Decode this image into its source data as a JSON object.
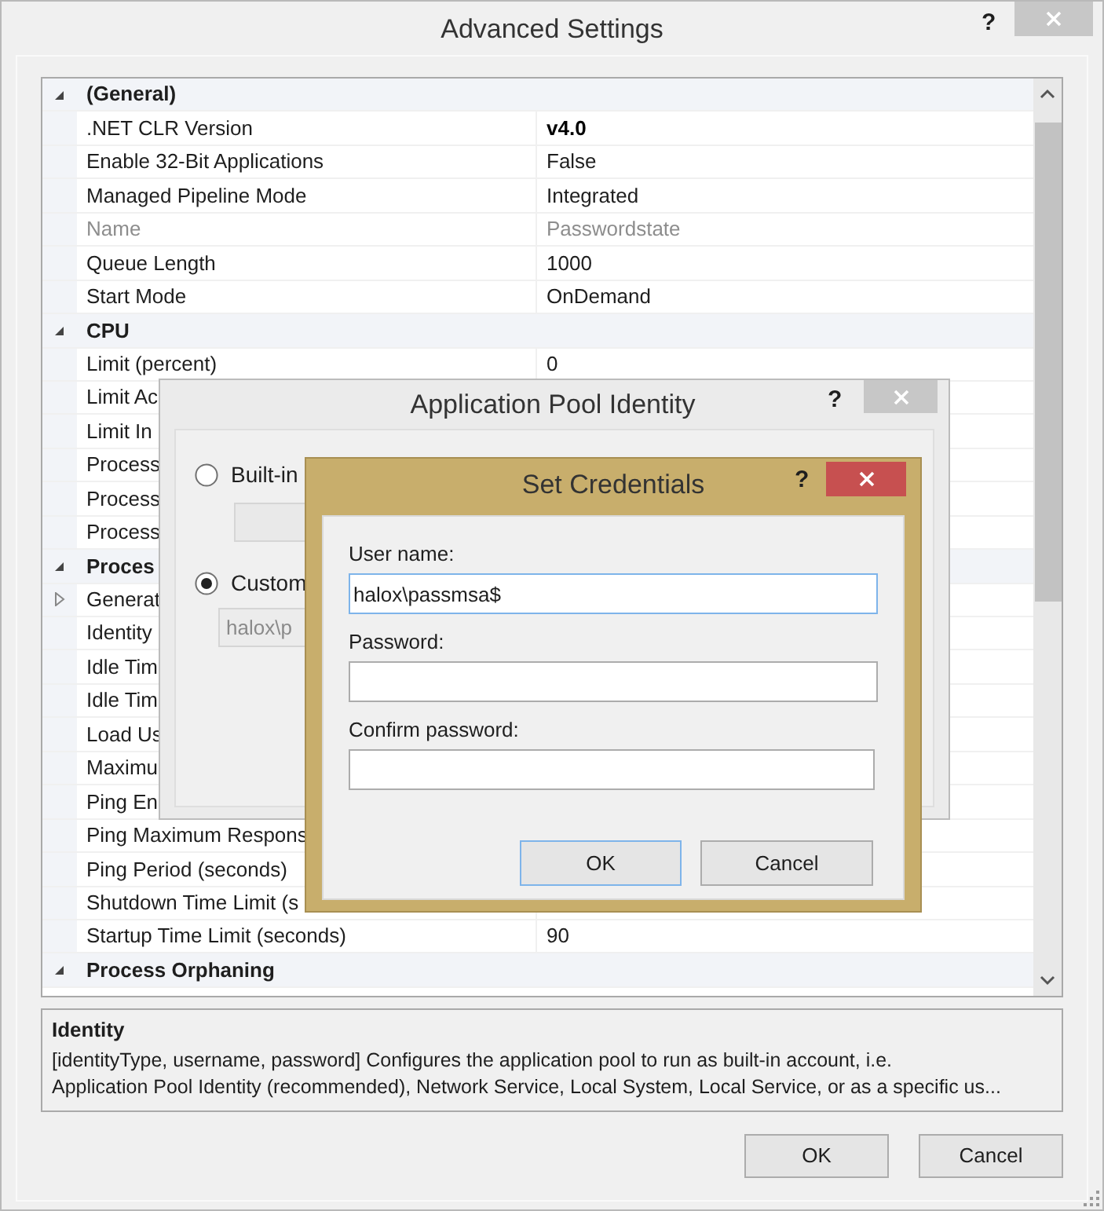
{
  "window": {
    "title": "Advanced Settings",
    "help": "?"
  },
  "property_grid": {
    "rows": [
      {
        "kind": "category",
        "name": "(General)",
        "expanded": true
      },
      {
        "kind": "property",
        "name": ".NET CLR Version",
        "value": "v4.0",
        "modified": true,
        "disabled": false
      },
      {
        "kind": "property",
        "name": "Enable 32-Bit Applications",
        "value": "False",
        "modified": false,
        "disabled": false
      },
      {
        "kind": "property",
        "name": "Managed Pipeline Mode",
        "value": "Integrated",
        "modified": false,
        "disabled": false
      },
      {
        "kind": "property",
        "name": "Name",
        "value": "Passwordstate",
        "modified": false,
        "disabled": true
      },
      {
        "kind": "property",
        "name": "Queue Length",
        "value": "1000",
        "modified": false,
        "disabled": false
      },
      {
        "kind": "property",
        "name": "Start Mode",
        "value": "OnDemand",
        "modified": false,
        "disabled": false
      },
      {
        "kind": "category",
        "name": "CPU",
        "expanded": true
      },
      {
        "kind": "property",
        "name": "Limit (percent)",
        "value": "0",
        "modified": false,
        "disabled": false
      },
      {
        "kind": "property",
        "name": "Limit Ac",
        "disabled": false
      },
      {
        "kind": "property",
        "name": "Limit In",
        "disabled": false
      },
      {
        "kind": "property",
        "name": "Process",
        "disabled": false
      },
      {
        "kind": "property",
        "name": "Process",
        "disabled": false
      },
      {
        "kind": "property",
        "name": "Process",
        "disabled": false
      },
      {
        "kind": "category",
        "name": "Proces",
        "expanded": true
      },
      {
        "kind": "group",
        "name": "Generat",
        "expanded": false
      },
      {
        "kind": "property",
        "name": "Identity",
        "disabled": false
      },
      {
        "kind": "property",
        "name": "Idle Tim",
        "disabled": false
      },
      {
        "kind": "property",
        "name": "Idle Tim",
        "disabled": false
      },
      {
        "kind": "property",
        "name": "Load Us",
        "disabled": false
      },
      {
        "kind": "property",
        "name": "Maximu",
        "disabled": false
      },
      {
        "kind": "property",
        "name": "Ping En",
        "disabled": false
      },
      {
        "kind": "property",
        "name": "Ping Maximum Respons",
        "disabled": false
      },
      {
        "kind": "property",
        "name": "Ping Period (seconds)",
        "disabled": false
      },
      {
        "kind": "property",
        "name": "Shutdown Time Limit (s",
        "disabled": false
      },
      {
        "kind": "property",
        "name": "Startup Time Limit (seconds)",
        "value": "90",
        "modified": false,
        "disabled": false
      },
      {
        "kind": "category",
        "name": "Process Orphaning",
        "expanded": true
      }
    ]
  },
  "description": {
    "title": "Identity",
    "text": "[identityType, username, password] Configures the application pool to run as built-in account, i.e.\nApplication Pool Identity (recommended), Network Service, Local System, Local Service, or as a specific us..."
  },
  "buttons": [
    "OK",
    "Cancel"
  ],
  "app_pool_identity_dialog": {
    "title": "Application Pool Identity",
    "help": "?",
    "options": [
      {
        "label": "Built-in",
        "selected": false
      },
      {
        "label": "Custom",
        "selected": true
      }
    ],
    "custom_account": "halox\\p"
  },
  "set_credentials_dialog": {
    "title": "Set Credentials",
    "help": "?",
    "fields": [
      {
        "label": "User name:",
        "value": "halox\\passmsa$",
        "focused": true
      },
      {
        "label": "Password:",
        "focused": false
      },
      {
        "label": "Confirm password:",
        "focused": false
      }
    ],
    "buttons": [
      {
        "label": "OK",
        "default": true
      },
      {
        "label": "Cancel",
        "default": false
      }
    ]
  }
}
